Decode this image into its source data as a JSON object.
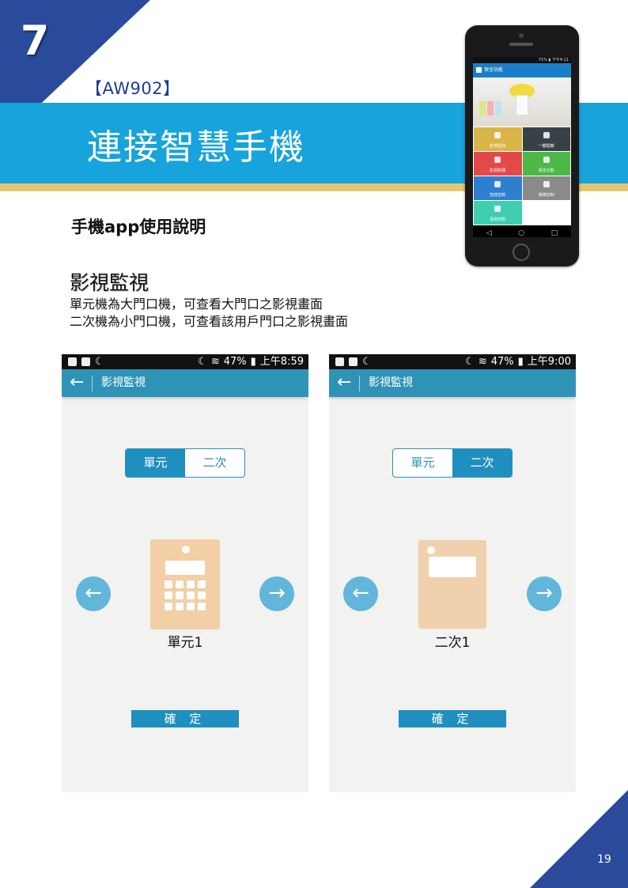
{
  "chapter": {
    "number": "7"
  },
  "model_tag": "【AW902】",
  "banner_title": "連接智慧手機",
  "section_title": "手機app使用說明",
  "sub_title": "影視監視",
  "description": [
    "單元機為大門口機，可查看大門口之影視畫面",
    "二次機為小門口機，可查看該用戶門口之影視畫面"
  ],
  "colors": {
    "corner_blue": "#2a4a9c",
    "banner_blue": "#17a3dc",
    "banner_gold": "#e6c770",
    "app_bar": "#2f93b7",
    "accent": "#1f8fbf",
    "device_tan": "#f2cfa5",
    "nav_circle": "#62b6dc"
  },
  "hero_phone": {
    "status_text": "71% ▮ 下午4:11",
    "header_title": "保全功能",
    "tiles": [
      {
        "label": "影視監視",
        "color": "#d9b548"
      },
      {
        "label": "一鍵開鎖",
        "color": "#3a4146"
      },
      {
        "label": "影視對講",
        "color": "#e24a4a"
      },
      {
        "label": "保全功能",
        "color": "#4cb848"
      },
      {
        "label": "智能控制",
        "color": "#2f7fd0"
      },
      {
        "label": "電梯控制",
        "color": "#8a8a8a"
      },
      {
        "label": "情境控制",
        "color": "#3fcfb0"
      }
    ],
    "nav": [
      "◁",
      "○",
      "□"
    ]
  },
  "screenshots": [
    {
      "status": {
        "battery": "47%",
        "time": "上午8:59"
      },
      "app_title": "影視監視",
      "tabs": [
        {
          "label": "單元",
          "active": true
        },
        {
          "label": "二次",
          "active": false
        }
      ],
      "device_label": "單元1",
      "confirm_label": "確 定",
      "icons": {
        "back": "←",
        "prev": "←",
        "next": "→"
      }
    },
    {
      "status": {
        "battery": "47%",
        "time": "上午9:00"
      },
      "app_title": "影視監視",
      "tabs": [
        {
          "label": "單元",
          "active": false
        },
        {
          "label": "二次",
          "active": true
        }
      ],
      "device_label": "二次1",
      "confirm_label": "確 定",
      "icons": {
        "back": "←",
        "prev": "←",
        "next": "→"
      }
    }
  ],
  "page_number": "19"
}
